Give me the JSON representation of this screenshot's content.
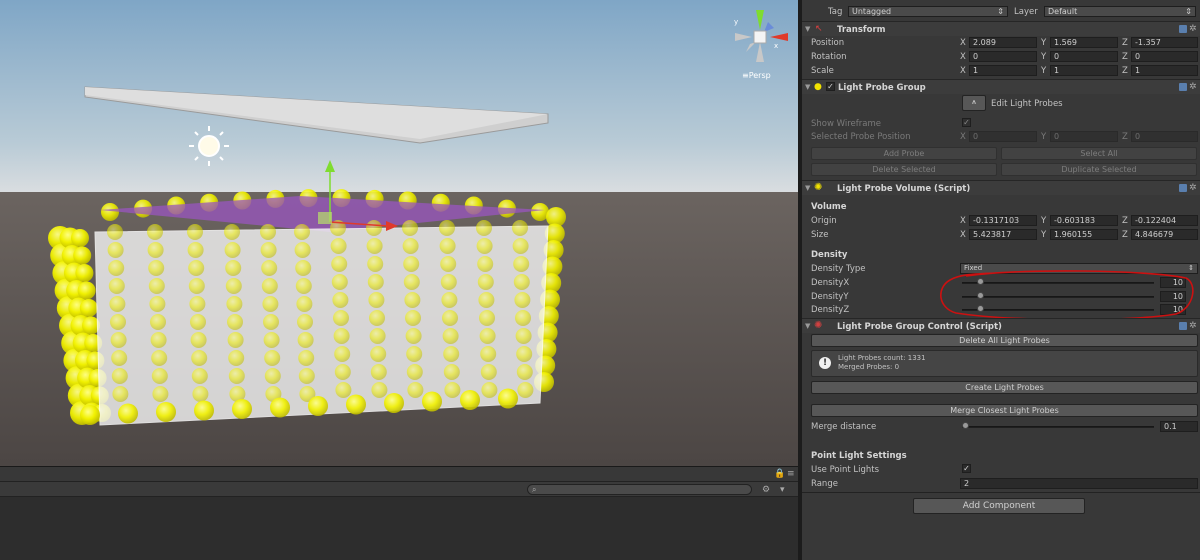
{
  "scene": {
    "persp_label": "≡Persp"
  },
  "header": {
    "tag_label": "Tag",
    "tag_value": "Untagged",
    "layer_label": "Layer",
    "layer_value": "Default"
  },
  "transform": {
    "title": "Transform",
    "position_label": "Position",
    "rotation_label": "Rotation",
    "scale_label": "Scale",
    "position": {
      "x": "2.089",
      "y": "1.569",
      "z": "-1.357"
    },
    "rotation": {
      "x": "0",
      "y": "0",
      "z": "0"
    },
    "scale": {
      "x": "1",
      "y": "1",
      "z": "1"
    }
  },
  "axes": {
    "x": "X",
    "y": "Y",
    "z": "Z"
  },
  "lpg": {
    "title": "Light Probe Group",
    "edit_label": "Edit Light Probes",
    "show_wireframe_label": "Show Wireframe",
    "selected_probe_label": "Selected Probe Position",
    "selected": {
      "x": "0",
      "y": "0",
      "z": "0"
    },
    "add_probe": "Add Probe",
    "select_all": "Select All",
    "delete_selected": "Delete Selected",
    "duplicate_selected": "Duplicate Selected"
  },
  "lpv": {
    "title": "Light Probe Volume (Script)",
    "volume_header": "Volume",
    "origin_label": "Origin",
    "size_label": "Size",
    "origin": {
      "x": "-0.1317103",
      "y": "-0.603183",
      "z": "-0.122404"
    },
    "size": {
      "x": "5.423817",
      "y": "1.960155",
      "z": "4.846679"
    },
    "density_header": "Density",
    "density_type_label": "Density Type",
    "density_type_value": "Fixed",
    "density_x_label": "DensityX",
    "density_y_label": "DensityY",
    "density_z_label": "DensityZ",
    "density_x": "10",
    "density_y": "10",
    "density_z": "10"
  },
  "lpgc": {
    "title": "Light Probe Group Control (Script)",
    "delete_all": "Delete All Light Probes",
    "info_count": "Light Probes count: 1331",
    "info_merged": "Merged Probes: 0",
    "create": "Create Light Probes",
    "merge": "Merge Closest Light Probes",
    "merge_distance_label": "Merge distance",
    "merge_distance_value": "0.1",
    "point_light_header": "Point Light Settings",
    "use_point_lights_label": "Use Point Lights",
    "range_label": "Range",
    "range_value": "2"
  },
  "add_component": "Add Component",
  "colors": {
    "probe_yellow": "#f2f200",
    "inspector_bg": "#383838",
    "annotation_red": "#cc1111"
  }
}
